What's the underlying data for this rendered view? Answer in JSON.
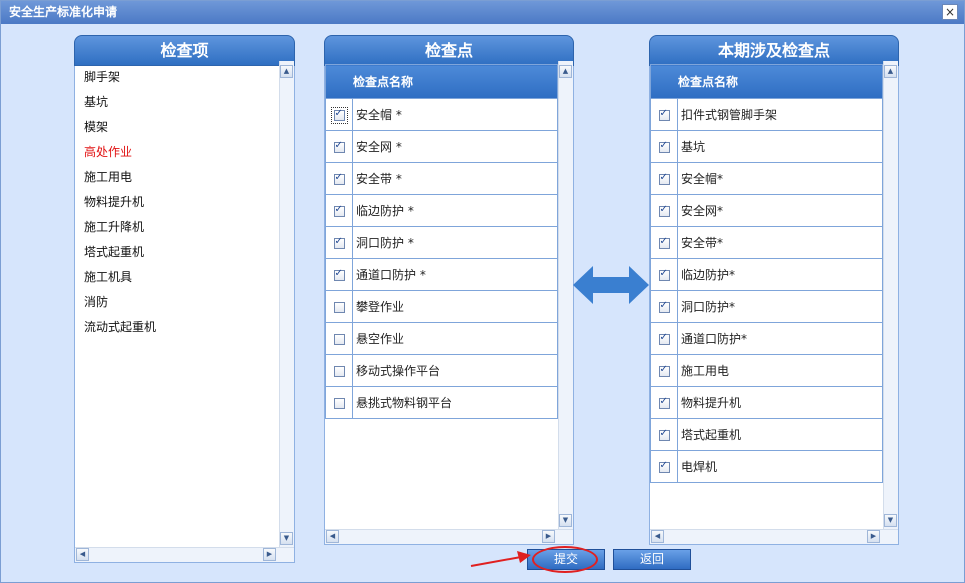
{
  "window": {
    "title": "安全生产标准化申请",
    "close_glyph": "×"
  },
  "left_panel": {
    "header": "检查项",
    "items": [
      {
        "label": "脚手架",
        "color": "#111111"
      },
      {
        "label": "基坑",
        "color": "#111111"
      },
      {
        "label": "模架",
        "color": "#111111"
      },
      {
        "label": "高处作业",
        "color": "#e11111"
      },
      {
        "label": "施工用电",
        "color": "#111111"
      },
      {
        "label": "物料提升机",
        "color": "#111111"
      },
      {
        "label": "施工升降机",
        "color": "#111111"
      },
      {
        "label": "塔式起重机",
        "color": "#111111"
      },
      {
        "label": "施工机具",
        "color": "#111111"
      },
      {
        "label": "消防",
        "color": "#111111"
      },
      {
        "label": "流动式起重机",
        "color": "#111111"
      }
    ]
  },
  "middle_panel": {
    "header": "检查点",
    "column_header": "检查点名称",
    "rows": [
      {
        "label": "安全帽 *",
        "checked": true,
        "focused": true
      },
      {
        "label": "安全网 *",
        "checked": true
      },
      {
        "label": "安全带 *",
        "checked": true
      },
      {
        "label": "临边防护 *",
        "checked": true
      },
      {
        "label": "洞口防护 *",
        "checked": true
      },
      {
        "label": "通道口防护 *",
        "checked": true
      },
      {
        "label": "攀登作业",
        "checked": false
      },
      {
        "label": "悬空作业",
        "checked": false
      },
      {
        "label": "移动式操作平台",
        "checked": false
      },
      {
        "label": "悬挑式物料钢平台",
        "checked": false
      }
    ]
  },
  "right_panel": {
    "header": "本期涉及检查点",
    "column_header": "检查点名称",
    "rows": [
      {
        "label": "扣件式钢管脚手架",
        "checked": true
      },
      {
        "label": "基坑",
        "checked": true
      },
      {
        "label": "安全帽*",
        "checked": true
      },
      {
        "label": "安全网*",
        "checked": true
      },
      {
        "label": "安全带*",
        "checked": true
      },
      {
        "label": "临边防护*",
        "checked": true
      },
      {
        "label": "洞口防护*",
        "checked": true
      },
      {
        "label": "通道口防护*",
        "checked": true
      },
      {
        "label": "施工用电",
        "checked": true
      },
      {
        "label": "物料提升机",
        "checked": true
      },
      {
        "label": "塔式起重机",
        "checked": true
      },
      {
        "label": "电焊机",
        "checked": true
      }
    ]
  },
  "icons": {
    "transfer": "double-arrow-icon",
    "scroll_up": "triangle-up-icon",
    "scroll_down": "triangle-down-icon",
    "scroll_left": "triangle-left-icon",
    "scroll_right": "triangle-right-icon"
  },
  "colors": {
    "accent": "#2f6fc2",
    "background": "#d6e5fc",
    "annotation": "#e02020",
    "arrow": "#3a7fd0"
  },
  "buttons": {
    "submit": "提交",
    "back": "返回"
  }
}
